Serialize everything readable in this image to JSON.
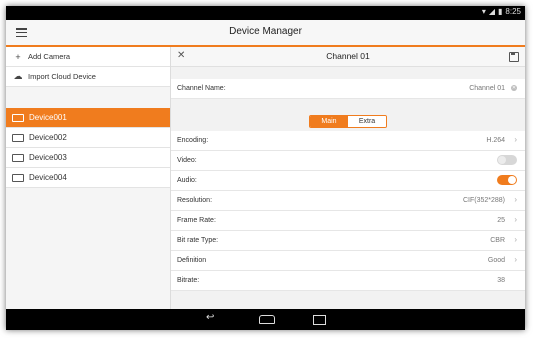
{
  "statusbar": {
    "time": "8:25",
    "icons": [
      "wifi-icon",
      "signal-icon",
      "battery-icon"
    ]
  },
  "appbar": {
    "title": "Device Manager",
    "menu_icon": "menu-icon"
  },
  "sidebar": {
    "actions": [
      {
        "label": "Add Camera",
        "icon": "plus-icon"
      },
      {
        "label": "Import Cloud Device",
        "icon": "cloud-icon"
      }
    ],
    "devices": [
      {
        "label": "Device001",
        "selected": true
      },
      {
        "label": "Device002",
        "selected": false
      },
      {
        "label": "Device003",
        "selected": false
      },
      {
        "label": "Device004",
        "selected": false
      }
    ]
  },
  "panel": {
    "title": "Channel 01",
    "channel_name": {
      "label": "Channel Name:",
      "value": "Channel 01"
    },
    "stream_tabs": {
      "main": "Main",
      "extra": "Extra",
      "selected": "Main"
    },
    "settings": {
      "encoding": {
        "label": "Encoding:",
        "value": "H.264"
      },
      "video": {
        "label": "Video:",
        "enabled": false
      },
      "audio": {
        "label": "Audio:",
        "enabled": true
      },
      "resolution": {
        "label": "Resolution:",
        "value": "CIF(352*288)"
      },
      "frame_rate": {
        "label": "Frame Rate:",
        "value": "25"
      },
      "bit_rate_type": {
        "label": "Bit rate Type:",
        "value": "CBR"
      },
      "definition": {
        "label": "Definition",
        "value": "Good"
      },
      "bitrate": {
        "label": "Bitrate:",
        "value": "38"
      }
    }
  },
  "colors": {
    "accent": "#f07c1e",
    "statusbar": "#000000",
    "background": "#f2f2f2"
  }
}
